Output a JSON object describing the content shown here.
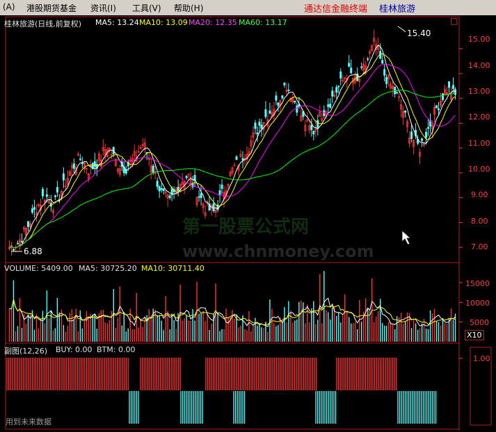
{
  "menu": {
    "items": [
      "(A)",
      "港股期货基金",
      "资讯(I)",
      "工具(V)",
      "帮助(H)"
    ],
    "brand": "通达信金融终端",
    "stock_name": "桂林旅游"
  },
  "price_panel": {
    "title": "桂林旅游(日线,前复权)",
    "ma5_label": "MA5: 13.24",
    "ma10_label": "MA10: 13.09",
    "ma20_label": "MA20: 12.35",
    "ma60_label": "MA60: 13.17",
    "high_marker": "15.40",
    "low_marker": "6.88",
    "axis_ticks": [
      "15.00",
      "14.00",
      "13.00",
      "12.00",
      "11.00",
      "10.00",
      "9.00",
      "8.00",
      "7.00"
    ],
    "corner_box": "□"
  },
  "volume_panel": {
    "vol_label": "VOLUME: 5409.00",
    "ma5_label": "MA5: 30725.20",
    "ma10_label": "MA10: 30711.40",
    "axis_ticks": [
      "15000",
      "10000",
      "5000"
    ],
    "unit": "X10"
  },
  "sub_panel": {
    "title": "副图(12,26)",
    "buy_label": "BUY: 0.00",
    "btm_label": "BTM: 0.00",
    "axis_tick": "1.00",
    "footer": "用到未来数据"
  },
  "watermark": {
    "line1": "第一股票公式网",
    "line2": "www.chnmoney.com"
  },
  "colors": {
    "up": "#ff3232",
    "down": "#54ffff",
    "ma5": "#ffffff",
    "ma10": "#ffff00",
    "ma20": "#ff00ff",
    "ma60": "#00ff00",
    "axis": "#ff3b3b",
    "border": "#b41e1e"
  },
  "chart_data": {
    "type": "candlestick",
    "price_range": [
      6.5,
      15.9
    ],
    "price_close_trend": [
      7.0,
      7.2,
      7.8,
      8.6,
      9.1,
      8.7,
      9.4,
      10.2,
      10.6,
      10.1,
      10.5,
      11.1,
      10.4,
      10.2,
      10.6,
      11.2,
      10.3,
      9.2,
      8.8,
      9.6,
      9.9,
      9.3,
      8.6,
      8.4,
      9.3,
      10.1,
      10.6,
      11.2,
      11.9,
      12.4,
      12.8,
      13.6,
      12.9,
      12.1,
      11.6,
      12.4,
      12.9,
      13.5,
      14.1,
      13.6,
      14.4,
      15.3,
      14.0,
      13.4,
      12.7,
      11.5,
      11.0,
      11.8,
      12.7,
      13.4,
      13.1
    ]
  }
}
